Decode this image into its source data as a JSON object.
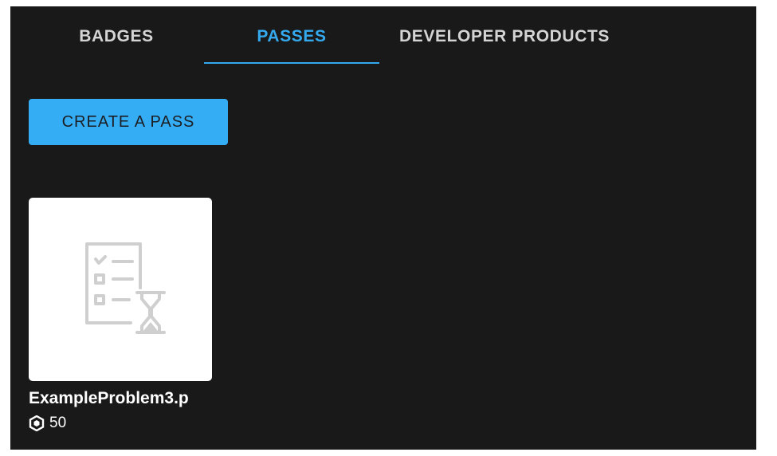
{
  "tabs": [
    {
      "label": "BADGES",
      "active": false
    },
    {
      "label": "PASSES",
      "active": true
    },
    {
      "label": "DEVELOPER PRODUCTS",
      "active": false
    }
  ],
  "create_button": {
    "label": "CREATE A PASS"
  },
  "passes": [
    {
      "name": "ExampleProblem3.p",
      "price": "50",
      "thumbnail_icon": "pending-checklist-icon",
      "currency_icon": "robux-icon"
    }
  ],
  "colors": {
    "background": "#191919",
    "accent": "#34a9ee",
    "button": "#35adf5",
    "tab_text": "#d4d4d4"
  }
}
